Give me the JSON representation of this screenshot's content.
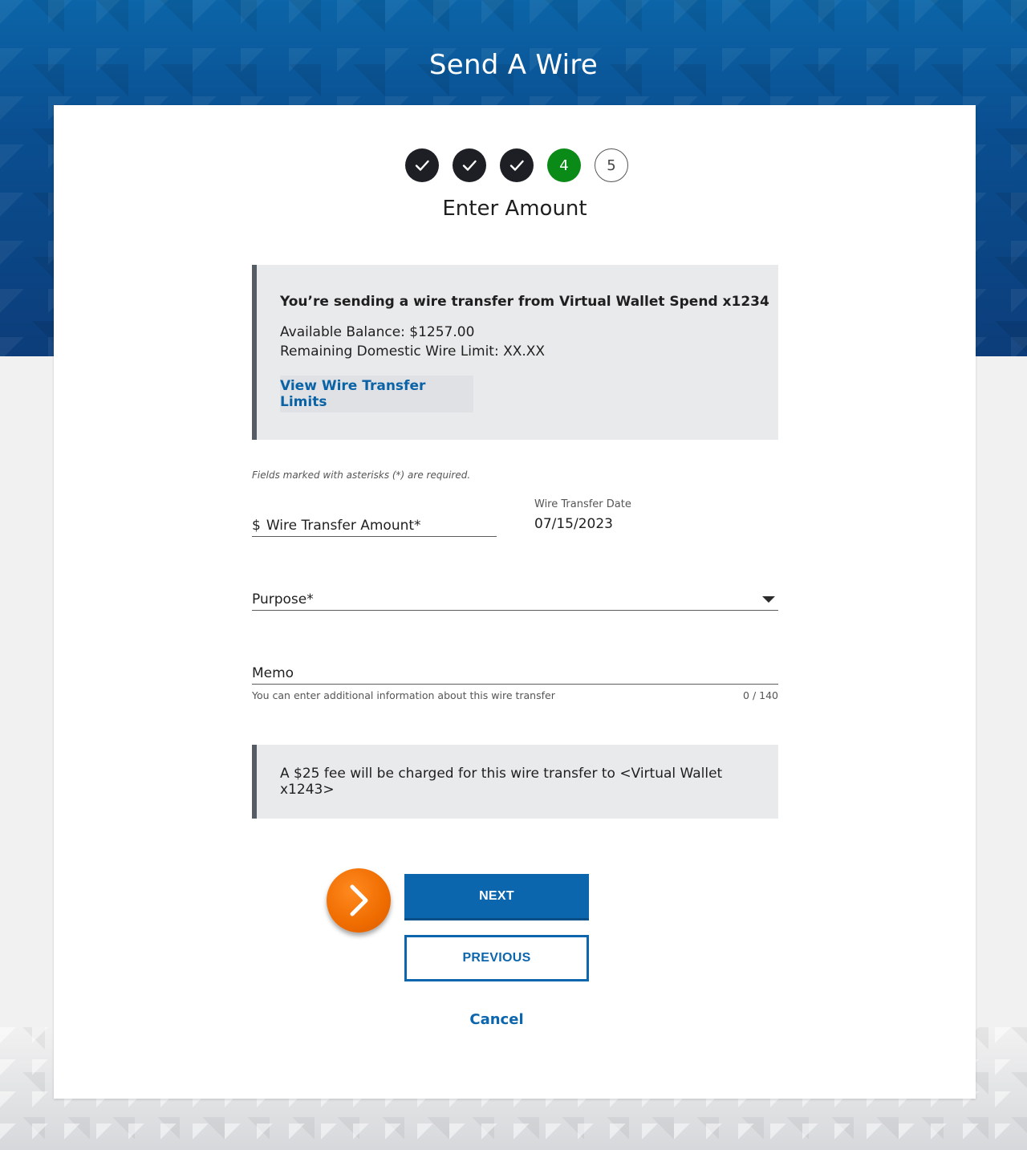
{
  "page": {
    "title": "Send A Wire"
  },
  "stepper": {
    "steps": [
      {
        "status": "done",
        "label": ""
      },
      {
        "status": "done",
        "label": ""
      },
      {
        "status": "done",
        "label": ""
      },
      {
        "status": "current",
        "label": "4"
      },
      {
        "status": "todo",
        "label": "5"
      }
    ],
    "title": "Enter Amount",
    "colors": {
      "done": "#1d1f24",
      "current": "#0a8a16"
    }
  },
  "info": {
    "heading": "You’re sending a wire transfer from Virtual Wallet Spend x1234",
    "available_balance": "Available Balance: $1257.00",
    "remaining_limit": "Remaining Domestic Wire Limit: XX.XX",
    "limits_link": "View Wire Transfer Limits"
  },
  "form": {
    "required_note": "Fields marked with asterisks (*) are required.",
    "amount": {
      "prefix": "$",
      "label": "Wire Transfer Amount*"
    },
    "date": {
      "label": "Wire Transfer Date",
      "value": "07/15/2023"
    },
    "purpose": {
      "label": "Purpose*",
      "icon": "chevron-down-icon"
    },
    "memo": {
      "label": "Memo",
      "help": "You can enter additional information about this wire transfer",
      "counter": "0 / 140"
    }
  },
  "fee_notice": "A $25 fee will be charged for this wire transfer to <Virtual Wallet x1243>",
  "actions": {
    "next": "NEXT",
    "previous": "PREVIOUS",
    "cancel": "Cancel",
    "accent_color": "#0b66ad",
    "pointer_icon": "chevron-right-icon"
  }
}
